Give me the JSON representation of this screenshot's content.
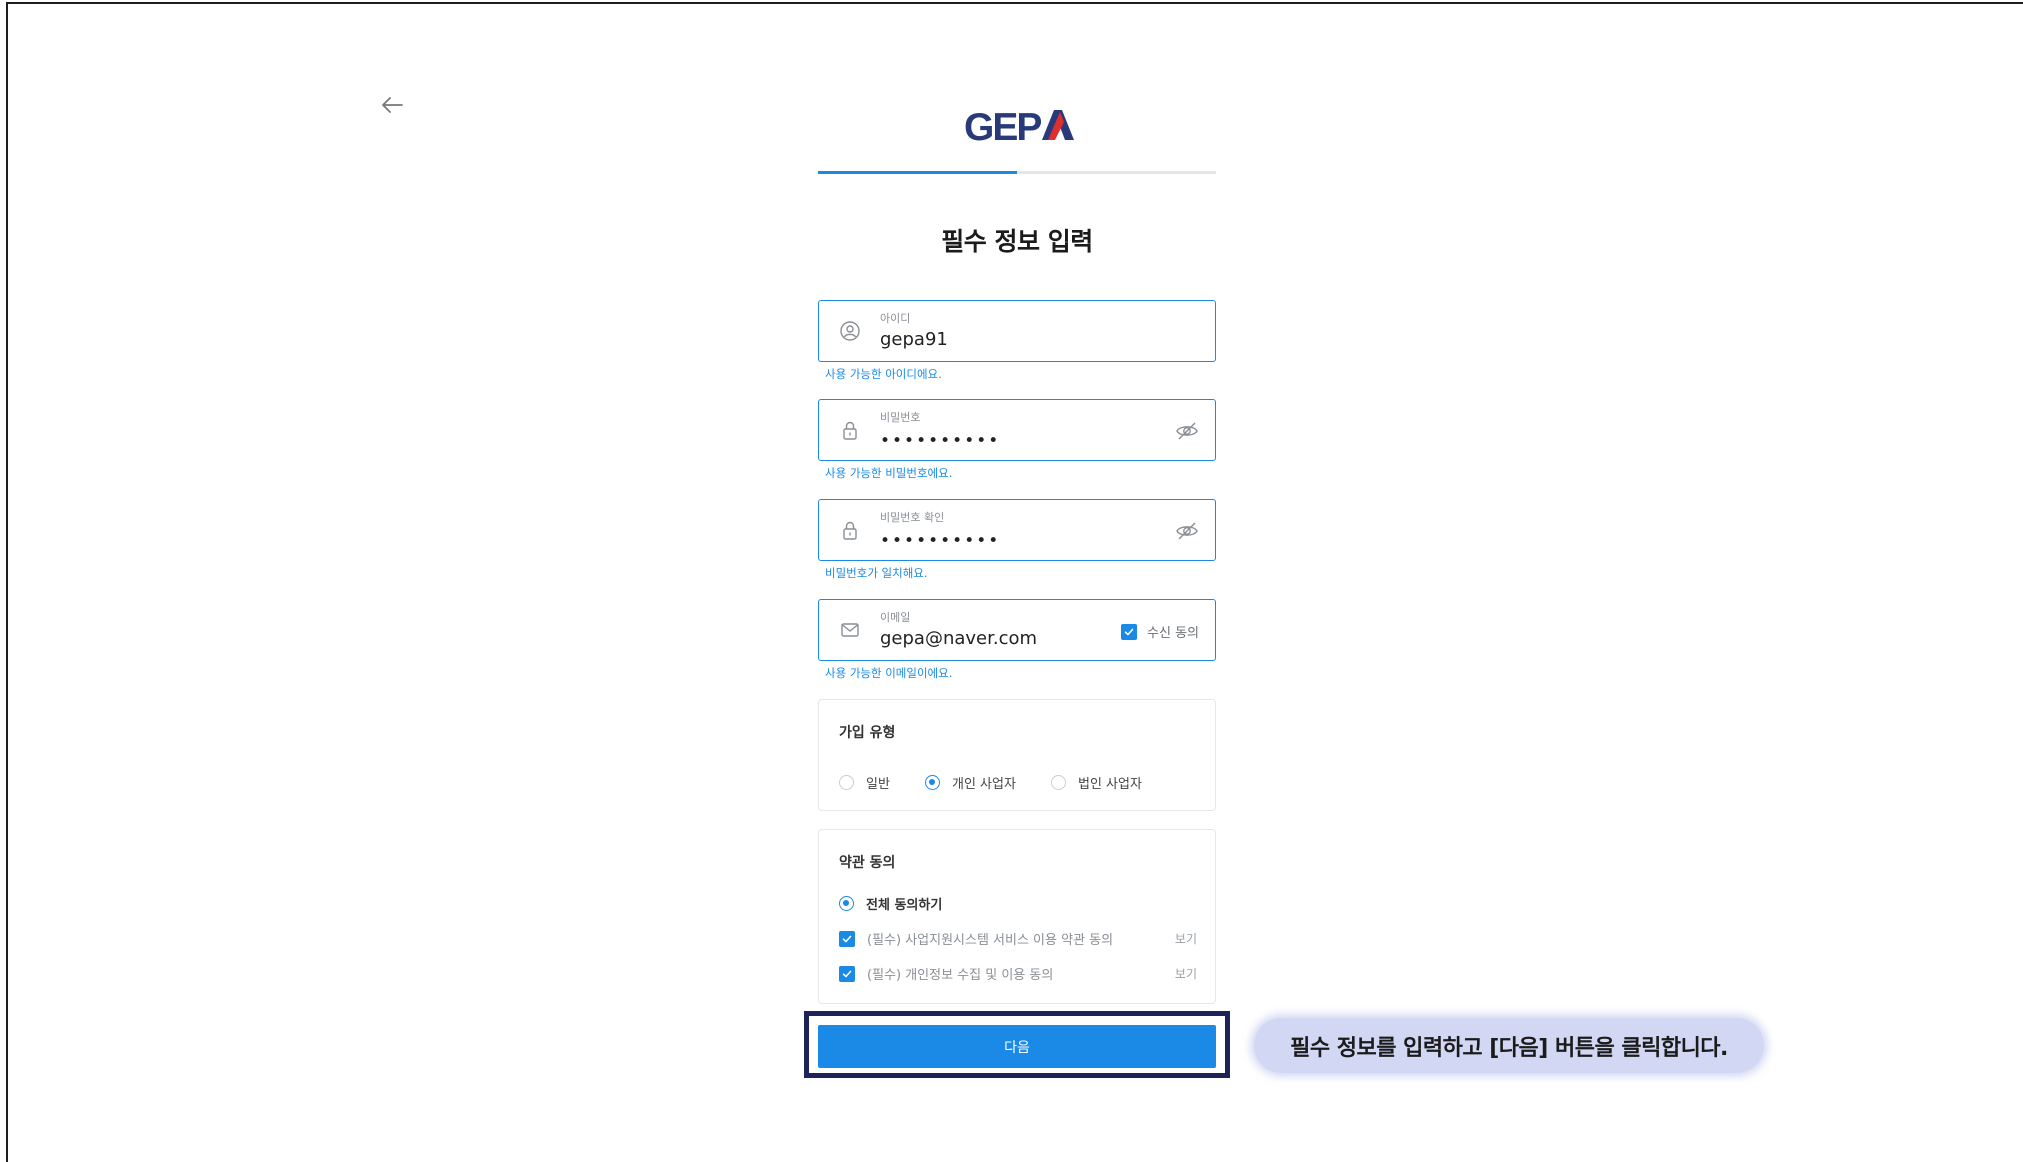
{
  "brand": {
    "logo_text": "GEPA",
    "color_dark": "#283a7a",
    "color_red": "#e02d2d"
  },
  "progress": {
    "step_fraction": 0.5
  },
  "page_title": "필수 정보 입력",
  "fields": {
    "userid": {
      "label": "아이디",
      "value": "gepa91",
      "helper": "사용 가능한 아이디에요."
    },
    "password": {
      "label": "비밀번호",
      "value": "••••••••••",
      "helper": "사용 가능한 비밀번호에요."
    },
    "password_confirm": {
      "label": "비밀번호 확인",
      "value": "••••••••••",
      "helper": "비밀번호가 일치해요."
    },
    "email": {
      "label": "이메일",
      "value": "gepa@naver.com",
      "consent_label": "수신 동의",
      "consent_checked": true,
      "helper": "사용 가능한 이메일이에요."
    }
  },
  "signup_type": {
    "title": "가입 유형",
    "options": [
      {
        "label": "일반",
        "selected": false
      },
      {
        "label": "개인 사업자",
        "selected": true
      },
      {
        "label": "법인 사업자",
        "selected": false
      }
    ]
  },
  "terms": {
    "title": "약관 동의",
    "all_agree_label": "전체 동의하기",
    "items": [
      {
        "label": "(필수) 사업지원시스템 서비스 이용 약관 동의",
        "checked": true,
        "view_label": "보기"
      },
      {
        "label": "(필수) 개인정보 수집 및 이용 동의",
        "checked": true,
        "view_label": "보기"
      }
    ]
  },
  "next_button": {
    "label": "다음"
  },
  "tooltip": {
    "text": "필수 정보를 입력하고 [다음] 버튼을 클릭합니다."
  },
  "colors": {
    "accent": "#1a8ae6",
    "highlight_border": "#1c2359",
    "tooltip_bg": "#d2d8f3"
  },
  "icons": {
    "back": "arrow-left-icon",
    "userid": "user-circle-icon",
    "password": "lock-icon",
    "email": "mail-icon",
    "visibility": "eye-off-icon",
    "check": "check-icon"
  }
}
